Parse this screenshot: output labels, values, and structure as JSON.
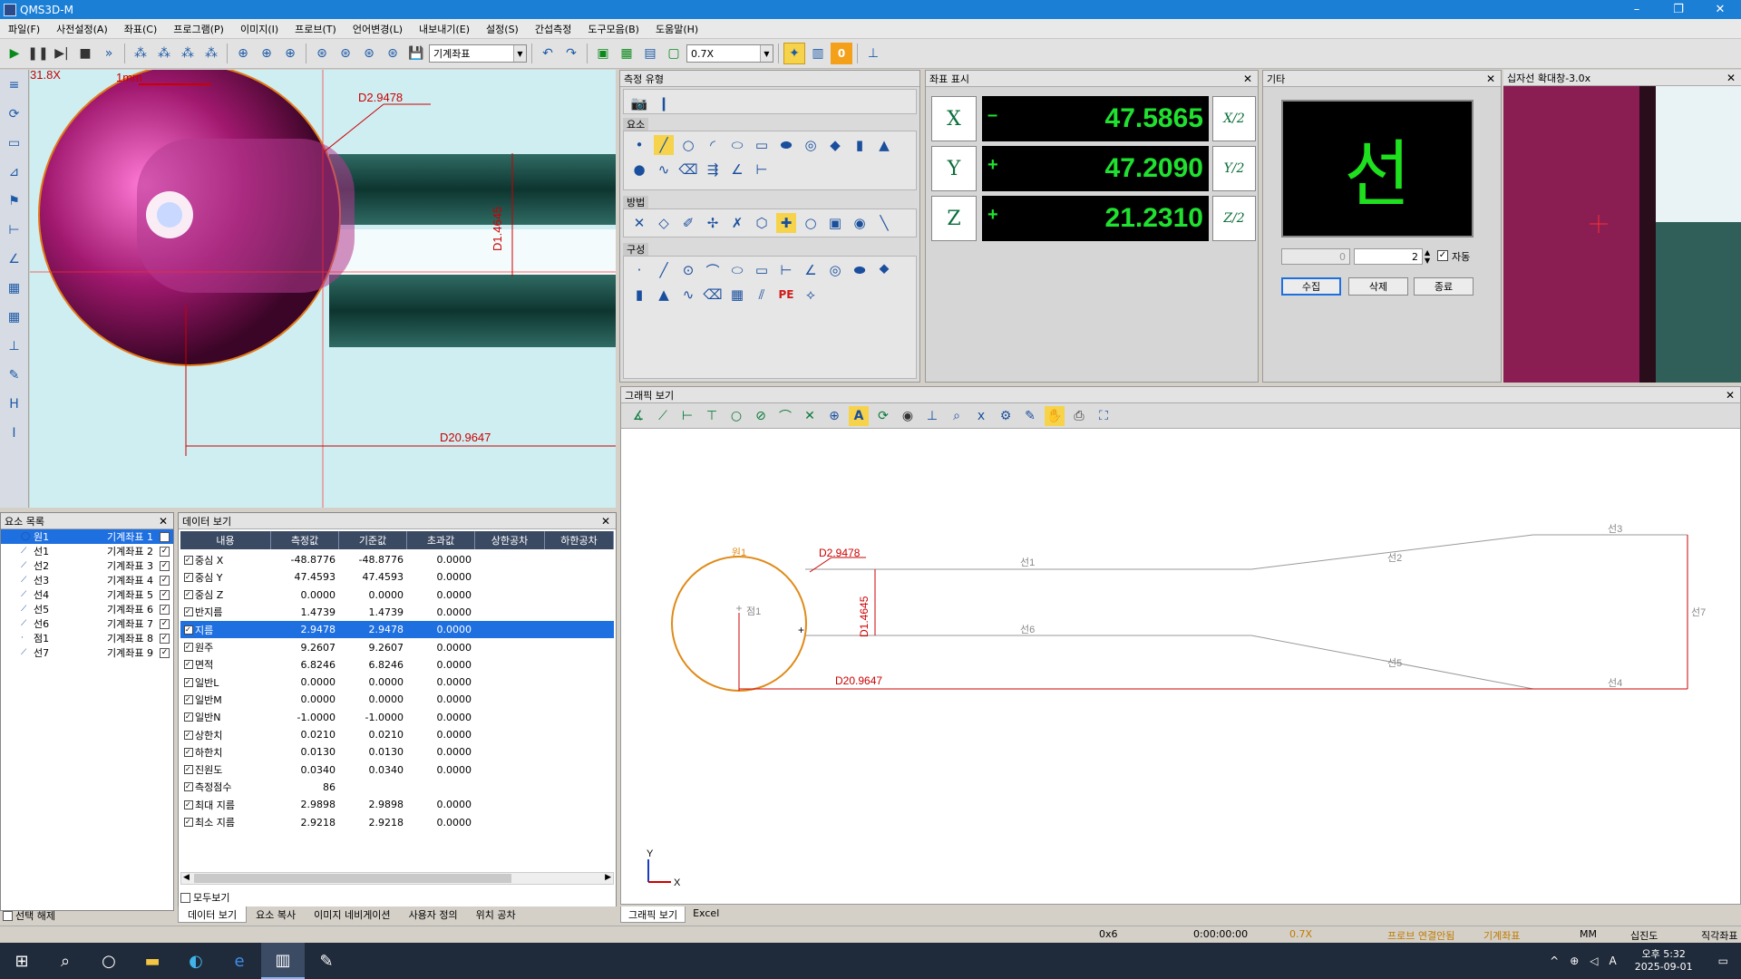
{
  "window": {
    "title": "QMS3D-M",
    "minimize": "–",
    "restore": "❐",
    "close": "✕"
  },
  "menu": [
    "파일(F)",
    "사전설정(A)",
    "좌표(C)",
    "프로그램(P)",
    "이미지(I)",
    "프로브(T)",
    "언어변경(L)",
    "내보내기(E)",
    "설정(S)",
    "간섭측정",
    "도구모음(B)",
    "도움말(H)"
  ],
  "toolbar": {
    "coord_system": "기계좌표",
    "zoom": "0.7X",
    "counter": "0"
  },
  "camera": {
    "scale": "31.8X",
    "scale_bar": "1mm",
    "dim_diameter": "D2.9478",
    "dim_height": "D1.4645",
    "dim_length": "D20.9647"
  },
  "meas_type": {
    "title": "측정 유형",
    "group_elements": "요소",
    "group_method": "방법",
    "group_construct": "구성",
    "pe_label": "PE"
  },
  "coord_panel": {
    "title": "좌표 표시",
    "rows": [
      {
        "axis": "X",
        "sign": "–",
        "value": "47.5865",
        "half": "X/2"
      },
      {
        "axis": "Y",
        "sign": "+",
        "value": "47.2090",
        "half": "Y/2"
      },
      {
        "axis": "Z",
        "sign": "+",
        "value": "21.2310",
        "half": "Z/2"
      }
    ]
  },
  "misc_panel": {
    "title": "기타",
    "big_text": "선",
    "num1": "0",
    "num2": "2",
    "auto_label": "자동",
    "btn_collect": "수집",
    "btn_delete": "삭제",
    "btn_end": "종료"
  },
  "zoom_panel": {
    "title": "십자선 확대창-3.0x"
  },
  "elements": {
    "title": "요소 목록",
    "items": [
      {
        "icon": "◯",
        "name": "원1",
        "coord": "기계좌표 1",
        "selected": true
      },
      {
        "icon": "⟋",
        "name": "선1",
        "coord": "기계좌표 2"
      },
      {
        "icon": "⟋",
        "name": "선2",
        "coord": "기계좌표 3"
      },
      {
        "icon": "⟋",
        "name": "선3",
        "coord": "기계좌표 4"
      },
      {
        "icon": "⟋",
        "name": "선4",
        "coord": "기계좌표 5"
      },
      {
        "icon": "⟋",
        "name": "선5",
        "coord": "기계좌표 6"
      },
      {
        "icon": "⟋",
        "name": "선6",
        "coord": "기계좌표 7"
      },
      {
        "icon": "·",
        "name": "점1",
        "coord": "기계좌표 8"
      },
      {
        "icon": "⟋",
        "name": "선7",
        "coord": "기계좌표 9"
      }
    ],
    "deselect": "선택 해제"
  },
  "dataview": {
    "title": "데이터 보기",
    "columns": [
      "내용",
      "측정값",
      "기준값",
      "초과값",
      "상한공차",
      "하한공차"
    ],
    "rows": [
      {
        "name": "중심 X",
        "meas": "-48.8776",
        "ref": "-48.8776",
        "over": "0.0000"
      },
      {
        "name": "중심 Y",
        "meas": "47.4593",
        "ref": "47.4593",
        "over": "0.0000"
      },
      {
        "name": "중심 Z",
        "meas": "0.0000",
        "ref": "0.0000",
        "over": "0.0000"
      },
      {
        "name": "반지름",
        "meas": "1.4739",
        "ref": "1.4739",
        "over": "0.0000"
      },
      {
        "name": "지름",
        "meas": "2.9478",
        "ref": "2.9478",
        "over": "0.0000",
        "selected": true
      },
      {
        "name": "원주",
        "meas": "9.2607",
        "ref": "9.2607",
        "over": "0.0000"
      },
      {
        "name": "면적",
        "meas": "6.8246",
        "ref": "6.8246",
        "over": "0.0000"
      },
      {
        "name": "일반L",
        "meas": "0.0000",
        "ref": "0.0000",
        "over": "0.0000"
      },
      {
        "name": "일반M",
        "meas": "0.0000",
        "ref": "0.0000",
        "over": "0.0000"
      },
      {
        "name": "일반N",
        "meas": "-1.0000",
        "ref": "-1.0000",
        "over": "0.0000"
      },
      {
        "name": "상한치",
        "meas": "0.0210",
        "ref": "0.0210",
        "over": "0.0000"
      },
      {
        "name": "하한치",
        "meas": "0.0130",
        "ref": "0.0130",
        "over": "0.0000"
      },
      {
        "name": "진원도",
        "meas": "0.0340",
        "ref": "0.0340",
        "over": "0.0000"
      },
      {
        "name": "측정점수",
        "meas": "86",
        "ref": "",
        "over": ""
      },
      {
        "name": "최대 지름",
        "meas": "2.9898",
        "ref": "2.9898",
        "over": "0.0000"
      },
      {
        "name": "최소 지름",
        "meas": "2.9218",
        "ref": "2.9218",
        "over": "0.0000"
      }
    ],
    "show_all": "모두보기"
  },
  "bottom_tabs": [
    "데이터 보기",
    "요소 복사",
    "이미지 네비게이션",
    "사용자 정의",
    "위치 공차"
  ],
  "graphic": {
    "title": "그래픽 보기",
    "labels": {
      "circle": "원1",
      "point": "점1",
      "diameter": "D2.9478",
      "height": "D1.4645",
      "length": "D20.9647",
      "l1": "선1",
      "l2": "선2",
      "l3": "선3",
      "l4": "선4",
      "l5": "선5",
      "l6": "선6",
      "l7": "선7",
      "axis_x": "X",
      "axis_y": "Y"
    },
    "tabs": [
      "그래픽 보기",
      "Excel"
    ]
  },
  "status": {
    "s1": "0x6",
    "s2": "0:00:00:00",
    "s3": "0.7X",
    "s4": "프로브 연결안됨",
    "s5": "기계좌표",
    "s6": "MM",
    "s7": "십진도",
    "s8": "직각좌표"
  },
  "taskbar": {
    "time": "오후 5:32",
    "date": "2025-09-01",
    "ime": "A"
  }
}
